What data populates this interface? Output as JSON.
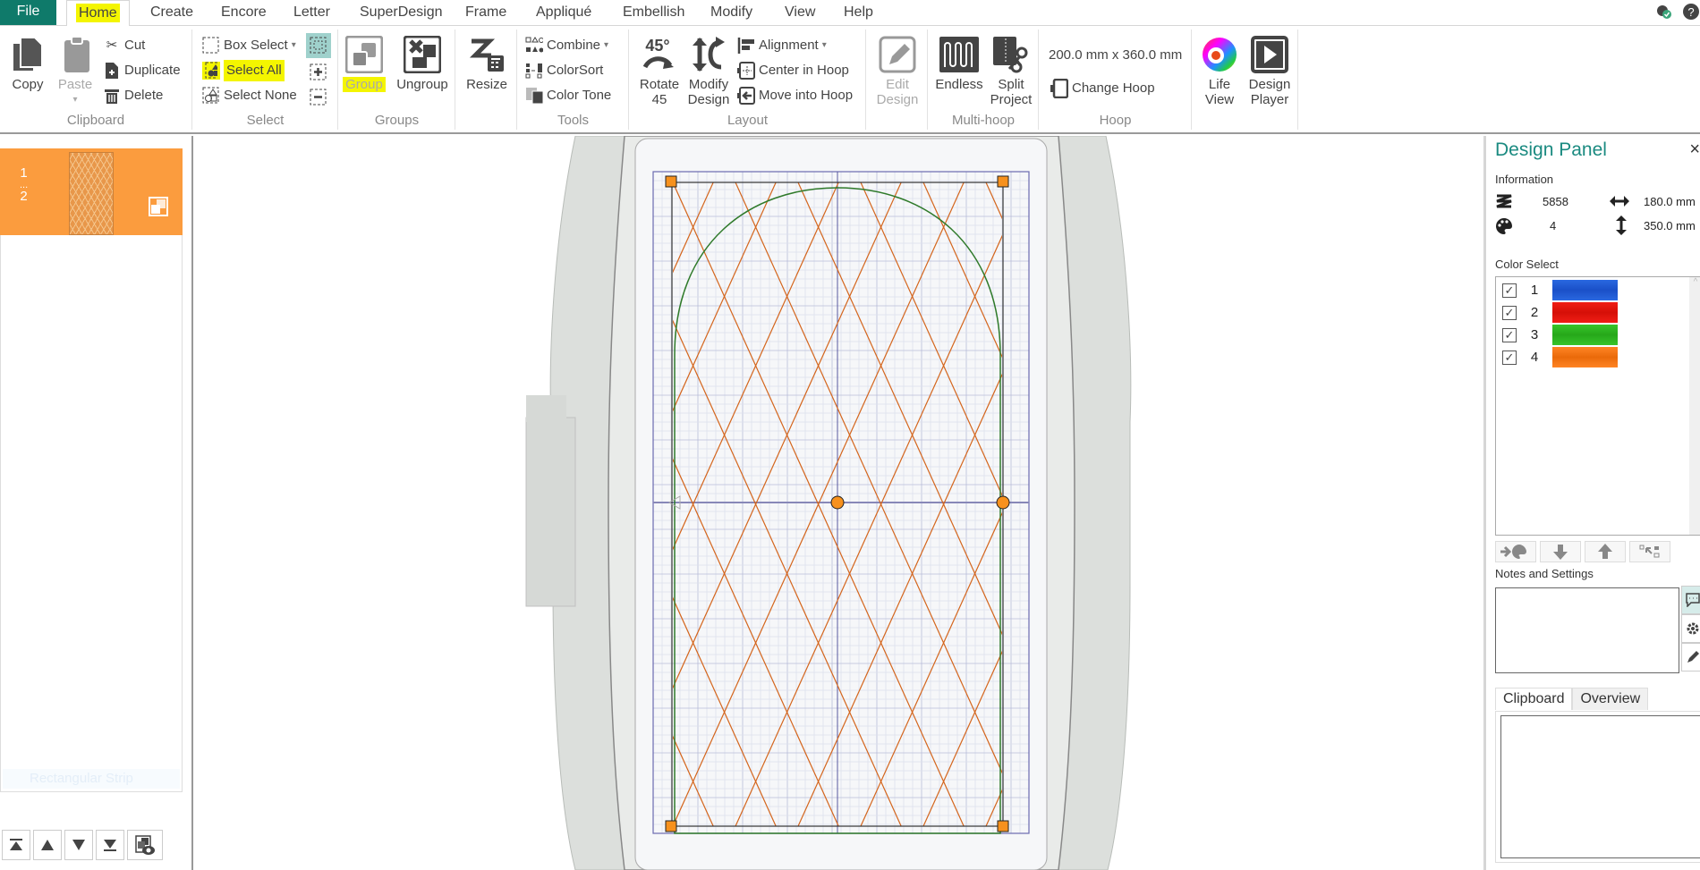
{
  "menubar": {
    "file_label": "File",
    "tabs": [
      {
        "label": "Home",
        "active": true
      },
      {
        "label": "Create"
      },
      {
        "label": "Encore"
      },
      {
        "label": "Letter"
      },
      {
        "label": "SuperDesign"
      },
      {
        "label": "Frame"
      },
      {
        "label": "Appliqué"
      },
      {
        "label": "Embellish"
      },
      {
        "label": "Modify"
      },
      {
        "label": "View"
      },
      {
        "label": "Help"
      }
    ],
    "icons": [
      "cloud-sync-icon",
      "help-icon"
    ]
  },
  "ribbon": {
    "clipboard": {
      "label": "Clipboard",
      "copy": "Copy",
      "paste": "Paste",
      "cut": "Cut",
      "duplicate": "Duplicate",
      "delete": "Delete"
    },
    "select": {
      "label": "Select",
      "box_select": "Box Select",
      "select_all": "Select All",
      "select_none": "Select None"
    },
    "groups": {
      "label": "Groups",
      "group": "Group",
      "ungroup": "Ungroup"
    },
    "resize": {
      "label": "Resize"
    },
    "tools": {
      "label": "Tools",
      "combine": "Combine",
      "colorsort": "ColorSort",
      "color_tone": "Color Tone"
    },
    "layout": {
      "label": "Layout",
      "rotate_line1": "Rotate",
      "rotate_line2": "45",
      "modify_line1": "Modify",
      "modify_line2": "Design",
      "alignment": "Alignment",
      "center_in_hoop": "Center in Hoop",
      "move_into_hoop": "Move into Hoop"
    },
    "edit": {
      "line1": "Edit",
      "line2": "Design"
    },
    "multihoop": {
      "label": "Multi-hoop",
      "endless": "Endless",
      "split_line1": "Split",
      "split_line2": "Project"
    },
    "hoop": {
      "label": "Hoop",
      "size": "200.0 mm x 360.0 mm",
      "change_hoop": "Change Hoop"
    },
    "view": {
      "life_line1": "Life",
      "life_line2": "View",
      "player_line1": "Design",
      "player_line2": "Player"
    }
  },
  "layers": {
    "item": {
      "num_top": "1",
      "num_mid": "...",
      "num_bottom": "2"
    },
    "faded_label": "Rectangular Strip"
  },
  "design_panel": {
    "title": "Design Panel",
    "close": "×",
    "information_label": "Information",
    "stitches": "5858",
    "width": "180.0 mm",
    "colors": "4",
    "height": "350.0 mm",
    "color_select_label": "Color Select",
    "colors_list": [
      {
        "num": "1",
        "color": "#1a55d0",
        "checked": true
      },
      {
        "num": "2",
        "color": "#e8150f",
        "checked": true
      },
      {
        "num": "3",
        "color": "#2fb822",
        "checked": true
      },
      {
        "num": "4",
        "color": "#f87412",
        "checked": true
      }
    ],
    "notes_label": "Notes and Settings",
    "bottom_tabs": [
      {
        "label": "Clipboard",
        "active": true
      },
      {
        "label": "Overview"
      }
    ]
  },
  "canvas": {
    "thread_colors": {
      "diamond": "#d4651c",
      "outline": "#2f7a2a",
      "handle": "#f7911d"
    }
  }
}
